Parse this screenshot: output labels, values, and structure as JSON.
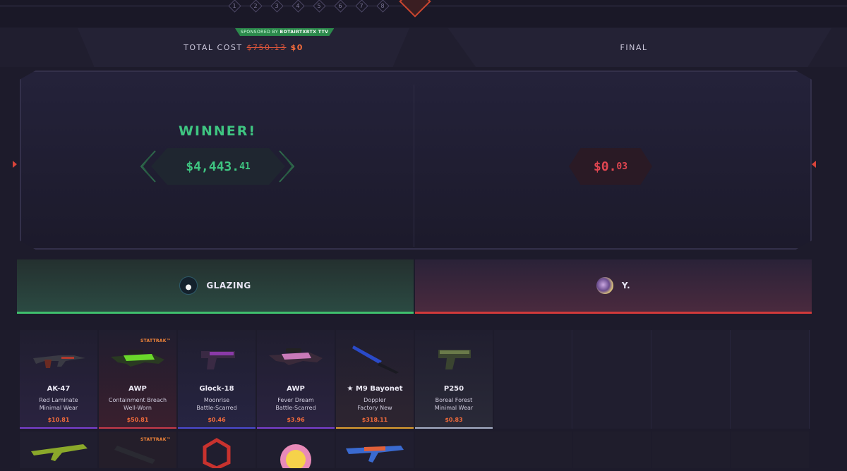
{
  "rounds": [
    "1",
    "2",
    "3",
    "4",
    "5",
    "6",
    "7",
    "8"
  ],
  "header": {
    "total_label": "TOTAL COST",
    "old_cost": "$750.13",
    "new_cost": "$0",
    "final_label": "FINAL",
    "sponsor_prefix": "SPONSORED BY",
    "sponsor_name": "BOTAIRTXRTX TTV"
  },
  "result": {
    "winner_label": "WINNER!",
    "left_amount_main": "$4,443.",
    "left_amount_cents": "41",
    "right_amount_main": "$0.",
    "right_amount_cents": "03"
  },
  "teams": {
    "left_name": "GLAZING",
    "right_name": "Y."
  },
  "colors": {
    "win": "#3fc581",
    "lose": "#e04550",
    "accent": "#f36b3b"
  },
  "left_items": [
    {
      "name": "AK-47",
      "skin": "Red Laminate",
      "wear": "Minimal Wear",
      "price": "$10.81",
      "stattrak": "",
      "bar": "#7b3fd0",
      "img": "rifle"
    },
    {
      "name": "AWP",
      "skin": "Containment Breach",
      "wear": "Well-Worn",
      "price": "$50.81",
      "stattrak": "STATTRAK™",
      "bar": "#c83a4a",
      "img": "sniper-green"
    },
    {
      "name": "Glock-18",
      "skin": "Moonrise",
      "wear": "Battle-Scarred",
      "price": "$0.46",
      "stattrak": "",
      "bar": "#4b4ad0",
      "img": "pistol"
    },
    {
      "name": "AWP",
      "skin": "Fever Dream",
      "wear": "Battle-Scarred",
      "price": "$3.96",
      "stattrak": "",
      "bar": "#7b3fd0",
      "img": "sniper-pink"
    },
    {
      "name": "★ M9 Bayonet",
      "skin": "Doppler",
      "wear": "Factory New",
      "price": "$318.11",
      "stattrak": "",
      "bar": "#e0a030",
      "img": "knife"
    }
  ],
  "right_items": [
    {
      "name": "P250",
      "skin": "Boreal Forest",
      "wear": "Minimal Wear",
      "price": "$0.83",
      "stattrak": "",
      "bar": "#a7b0c8",
      "img": "pistol-green"
    }
  ],
  "row2_stattrak": "STATTRAK™"
}
